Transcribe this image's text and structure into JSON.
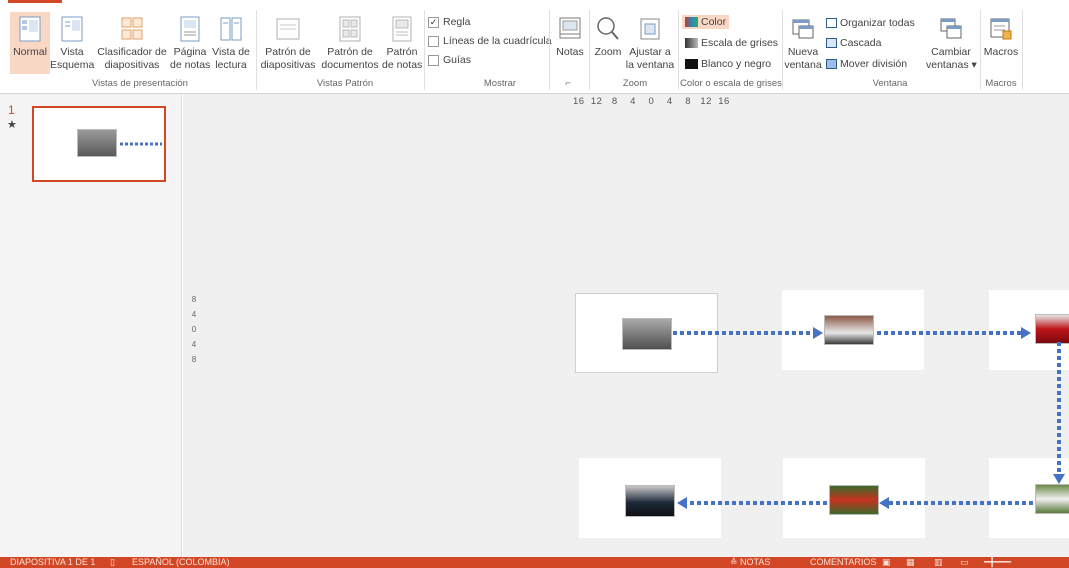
{
  "ribbon": {
    "groups": {
      "vistas_presentacion": "Vistas de presentación",
      "vistas_patron": "Vistas Patrón",
      "mostrar": "Mostrar",
      "zoom": "Zoom",
      "color": "Color o escala de grises",
      "ventana": "Ventana",
      "macros": "Macros"
    },
    "buttons": {
      "normal": "Normal",
      "vista_esquema_1": "Vista",
      "vista_esquema_2": "Esquema",
      "clasificador_1": "Clasificador de",
      "clasificador_2": "diapositivas",
      "pagina_notas_1": "Página",
      "pagina_notas_2": "de notas",
      "vista_lectura_1": "Vista de",
      "vista_lectura_2": "lectura",
      "patron_diap_1": "Patrón de",
      "patron_diap_2": "diapositivas",
      "patron_doc_1": "Patrón de",
      "patron_doc_2": "documentos",
      "patron_notas_1": "Patrón",
      "patron_notas_2": "de notas",
      "notas": "Notas",
      "zoom": "Zoom",
      "ajustar_1": "Ajustar a",
      "ajustar_2": "la ventana",
      "nueva_ventana_1": "Nueva",
      "nueva_ventana_2": "ventana",
      "cambiar_1": "Cambiar",
      "cambiar_2": "ventanas ▾",
      "macros": "Macros"
    },
    "checks": {
      "regla": "Regla",
      "lineas": "Líneas de la cuadrícula",
      "guias": "Guías"
    },
    "color_options": {
      "color": "Color",
      "grises": "Escala de grises",
      "blanco_negro": "Blanco y negro"
    },
    "window_options": {
      "organizar": "Organizar todas",
      "cascada": "Cascada",
      "mover": "Mover división"
    }
  },
  "thumbs": {
    "number": "1",
    "star": "★"
  },
  "rulers": {
    "horizontal": "16  12   8    4    0    4    8   12  16",
    "vertical": [
      "8",
      "4",
      "0",
      "4",
      "8"
    ]
  },
  "status": {
    "slide": "DIAPOSITIVA 1 DE 1",
    "language": "ESPAÑOL (COLOMBIA)",
    "notes": "≙ NOTAS",
    "comments": "COMENTARIOS"
  },
  "colors": {
    "accent": "#d24726",
    "connector": "#4472c4"
  }
}
